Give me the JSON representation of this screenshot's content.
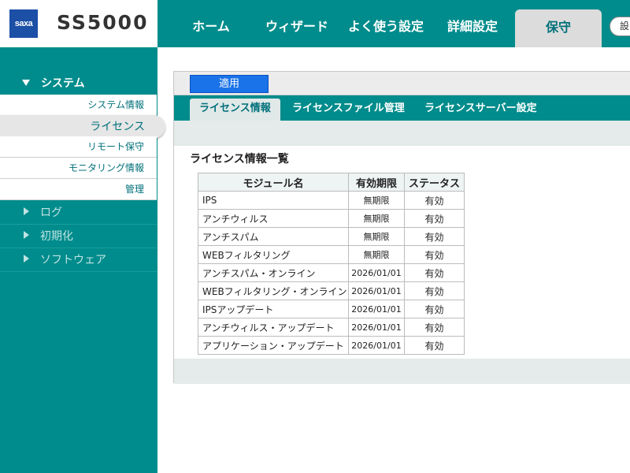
{
  "brand": {
    "logo_text": "saxa",
    "product": "SS5000"
  },
  "nav": {
    "items": [
      {
        "label": "ホーム"
      },
      {
        "label": "ウィザード"
      },
      {
        "label": "よく使う設定"
      },
      {
        "label": "詳細設定"
      },
      {
        "label": "保守",
        "active": true
      }
    ],
    "logout_label": "設"
  },
  "sidebar": {
    "section": "システム",
    "subitems": [
      {
        "label": "システム情報"
      },
      {
        "label": "ライセンス",
        "selected": true
      },
      {
        "label": "リモート保守"
      },
      {
        "label": "モニタリング情報"
      },
      {
        "label": "管理"
      }
    ],
    "categories": [
      {
        "label": "ログ"
      },
      {
        "label": "初期化"
      },
      {
        "label": "ソフトウェア"
      }
    ]
  },
  "toolbar": {
    "apply_label": "適用"
  },
  "tabs": [
    {
      "label": "ライセンス情報",
      "active": true
    },
    {
      "label": "ライセンスファイル管理"
    },
    {
      "label": "ライセンスサーバー設定"
    }
  ],
  "section_title": "ライセンス情報一覧",
  "table": {
    "headers": [
      "モジュール名",
      "有効期限",
      "ステータス"
    ],
    "rows": [
      [
        "IPS",
        "無期限",
        "有効"
      ],
      [
        "アンチウィルス",
        "無期限",
        "有効"
      ],
      [
        "アンチスパム",
        "無期限",
        "有効"
      ],
      [
        "WEBフィルタリング",
        "無期限",
        "有効"
      ],
      [
        "アンチスパム・オンライン",
        "2026/01/01",
        "有効"
      ],
      [
        "WEBフィルタリング・オンライン",
        "2026/01/01",
        "有効"
      ],
      [
        "IPSアップデート",
        "2026/01/01",
        "有効"
      ],
      [
        "アンチウィルス・アップデート",
        "2026/01/01",
        "有効"
      ],
      [
        "アプリケーション・アップデート",
        "2026/01/01",
        "有効"
      ]
    ]
  },
  "colors": {
    "teal": "#008c8c",
    "apply_blue": "#1a73e8",
    "logo_blue": "#1c4fa6"
  }
}
